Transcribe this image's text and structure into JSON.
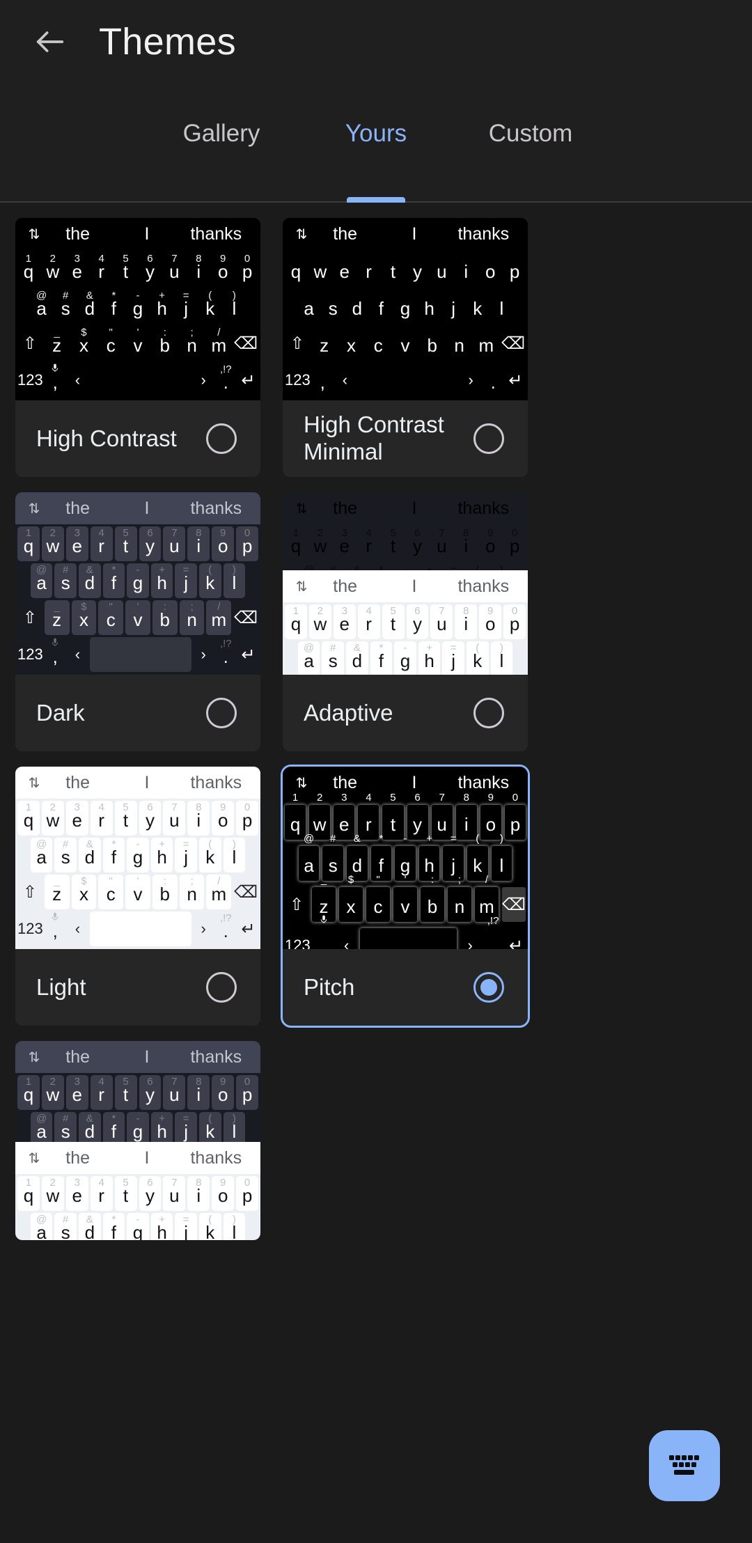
{
  "appbar": {
    "back_icon": "arrow-left-icon",
    "title": "Themes"
  },
  "tabs": {
    "items": [
      {
        "label": "Gallery",
        "active": false
      },
      {
        "label": "Yours",
        "active": true
      },
      {
        "label": "Custom",
        "active": false
      }
    ],
    "active_index": 1,
    "accent_color": "#8ab4f8"
  },
  "keyboard_preview": {
    "suggestions": [
      "the",
      "I",
      "thanks"
    ],
    "row1_letters": [
      "q",
      "w",
      "e",
      "r",
      "t",
      "y",
      "u",
      "i",
      "o",
      "p"
    ],
    "row1_hints": [
      "1",
      "2",
      "3",
      "4",
      "5",
      "6",
      "7",
      "8",
      "9",
      "0"
    ],
    "row2_letters": [
      "a",
      "s",
      "d",
      "f",
      "g",
      "h",
      "j",
      "k",
      "l"
    ],
    "row2_hints": [
      "@",
      "#",
      "&",
      "*",
      "-",
      "+",
      "=",
      "(",
      ")"
    ],
    "row3_letters": [
      "z",
      "x",
      "c",
      "v",
      "b",
      "n",
      "m"
    ],
    "row3_hints": [
      "_",
      "$",
      "\"",
      "'",
      ":",
      ";",
      "/"
    ],
    "shift_key": "⇧",
    "backspace_key": "⌫",
    "numeric_key": "123",
    "comma_key": ",",
    "comma_hint": "mic-icon",
    "emoji_key": "‹",
    "space_key": "",
    "period_key": ".",
    "period_hint": ",!?",
    "enter_key": "↵",
    "arrow_key": "›"
  },
  "themes": [
    {
      "name": "High Contrast",
      "style": "t-hc",
      "selected": false
    },
    {
      "name": "High Contrast Minimal",
      "style": "t-hcm",
      "selected": false
    },
    {
      "name": "Dark",
      "style": "t-dark",
      "selected": false
    },
    {
      "name": "Adaptive",
      "style": "t-adaptive",
      "selected": false
    },
    {
      "name": "Light",
      "style": "t-light",
      "selected": false
    },
    {
      "name": "Pitch",
      "style": "t-pitch",
      "selected": true
    }
  ],
  "fab": {
    "icon": "keyboard-icon",
    "color": "#8ab4f8"
  },
  "colors": {
    "background": "#1b1b1b",
    "card": "#262626",
    "accent": "#8ab4f8",
    "text_primary": "#eceff1"
  }
}
